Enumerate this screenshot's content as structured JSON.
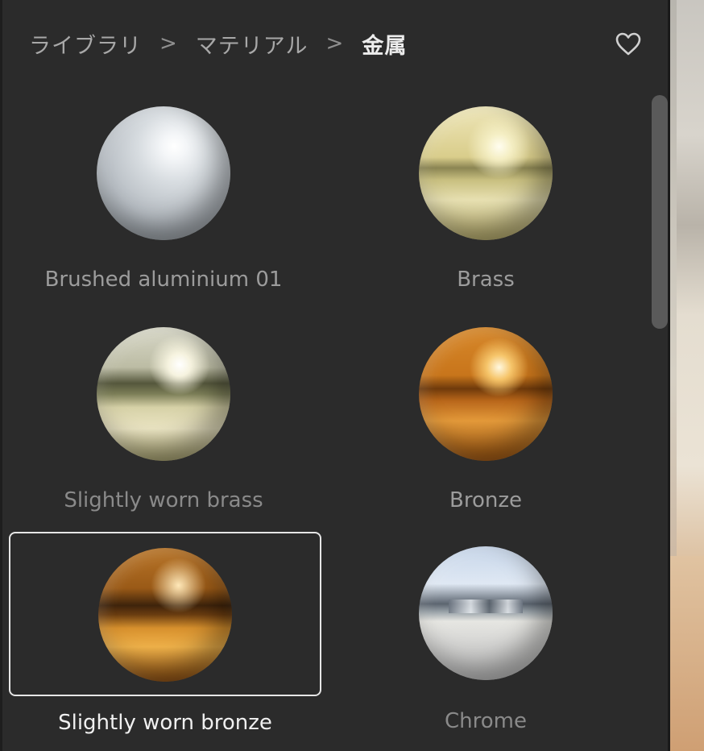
{
  "breadcrumb": {
    "items": [
      "ライブラリ",
      "マテリアル",
      "金属"
    ],
    "separator": ">"
  },
  "favorite_icon": "heart-outline-icon",
  "materials": [
    {
      "label": "Brushed aluminium 01",
      "material": "aluminium",
      "selected": false
    },
    {
      "label": "Brass",
      "material": "brass",
      "selected": false
    },
    {
      "label": "Slightly worn brass",
      "material": "worn-brass",
      "selected": false
    },
    {
      "label": "Bronze",
      "material": "bronze",
      "selected": false
    },
    {
      "label": "Slightly worn bronze",
      "material": "worn-bronze",
      "selected": true
    },
    {
      "label": "Chrome",
      "material": "chrome",
      "selected": false
    }
  ],
  "colors": {
    "panel_bg": "#2b2b2b",
    "selected_border": "#e6e6e6",
    "label_text": "#9c9c9c",
    "active_label_text": "#f0f0f0"
  }
}
